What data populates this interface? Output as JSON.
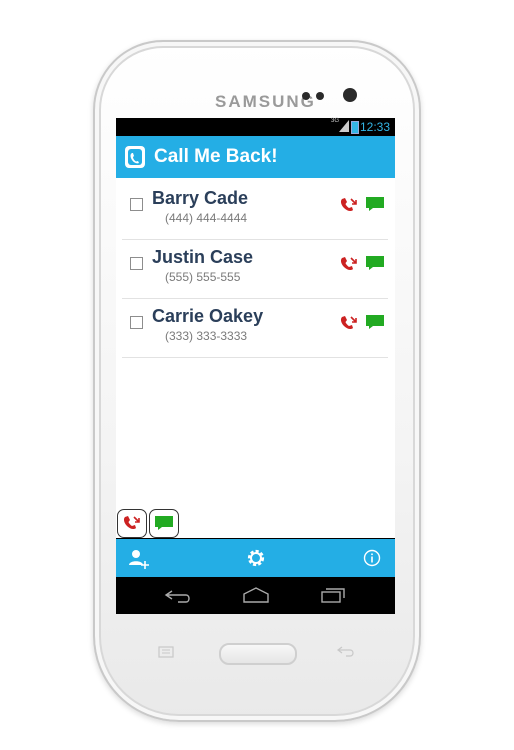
{
  "device": {
    "brand": "SAMSUNG"
  },
  "status_bar": {
    "time": "12:33",
    "network": "3G"
  },
  "action_bar": {
    "title": "Call Me Back!",
    "icon": "phone-app-icon"
  },
  "contacts": [
    {
      "name": "Barry Cade",
      "phone": "(444) 444-4444",
      "checked": false
    },
    {
      "name": "Justin Case",
      "phone": "(555) 555-555",
      "checked": false
    },
    {
      "name": "Carrie Oakey",
      "phone": "(333) 333-3333",
      "checked": false
    }
  ],
  "bottom_actions": [
    "call-back-icon",
    "message-icon"
  ],
  "toolbar": [
    "add-contact-icon",
    "settings-gear-icon",
    "info-icon"
  ],
  "nav_bar": [
    "back-icon",
    "home-icon",
    "recent-apps-icon"
  ],
  "colors": {
    "accent": "#24aee5",
    "call": "#cc2222",
    "message": "#22aa22",
    "name_text": "#2b3f5a"
  }
}
